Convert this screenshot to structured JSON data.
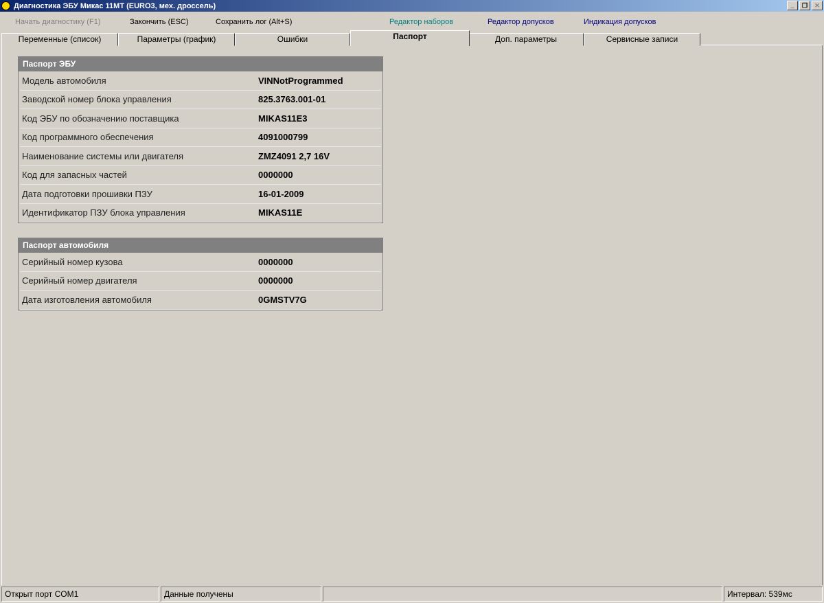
{
  "window": {
    "title": "Диагностика ЭБУ Микас 11МТ (EURO3, мех. дроссель)",
    "min": "_",
    "restore": "❐",
    "close": "✕"
  },
  "toolbar": {
    "start": "Начать диагностику (F1)",
    "stop": "Закончить (ESC)",
    "save_log": "Сохранить лог (Alt+S)",
    "set_editor": "Редактор наборов",
    "tol_editor": "Редактор допусков",
    "tol_indication": "Индикация допусков"
  },
  "tabs": [
    "Переменные (список)",
    "Параметры (график)",
    "Ошибки",
    "Паспорт",
    "Доп. параметры",
    "Сервисные записи"
  ],
  "ecu": {
    "title": "Паспорт ЭБУ",
    "rows": [
      {
        "k": "Модель автомобиля",
        "v": "VINNotProgrammed"
      },
      {
        "k": "Заводской номер блока управления",
        "v": "825.3763.001-01"
      },
      {
        "k": "Код ЭБУ по обозначению поставщика",
        "v": "MIKAS11E3"
      },
      {
        "k": "Код программного обеспечения",
        "v": "4091000799"
      },
      {
        "k": "Наименование системы или двигателя",
        "v": "ZMZ4091 2,7 16V"
      },
      {
        "k": "Код для запасных частей",
        "v": "0000000"
      },
      {
        "k": "Дата подготовки прошивки ПЗУ",
        "v": "16-01-2009"
      },
      {
        "k": "Идентификатор ПЗУ блока управления",
        "v": "MIKAS11E"
      }
    ]
  },
  "car": {
    "title": "Паспорт автомобиля",
    "rows": [
      {
        "k": "Серийный номер кузова",
        "v": "0000000"
      },
      {
        "k": "Серийный номер двигателя",
        "v": "0000000"
      },
      {
        "k": "Дата изготовления автомобиля",
        "v": "0GMSTV7G"
      }
    ]
  },
  "status": {
    "port": "Открыт порт COM1",
    "data": "Данные получены",
    "empty": "",
    "interval": "Интервал: 539мс"
  }
}
